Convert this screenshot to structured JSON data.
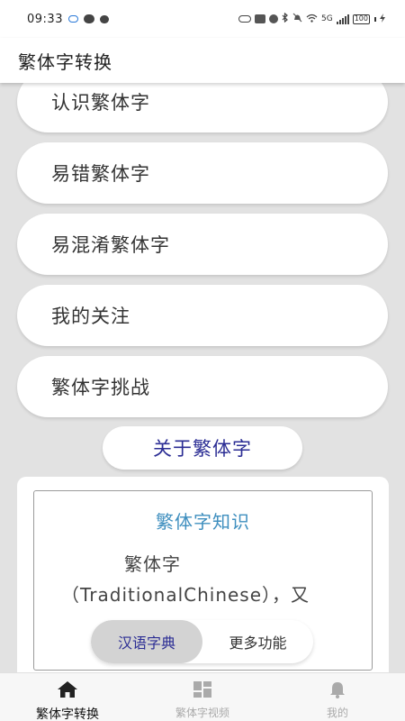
{
  "status_bar": {
    "time": "09:33",
    "signal_label": "5G",
    "battery": "100"
  },
  "header": {
    "title": "繁体字转换"
  },
  "menu": {
    "items": [
      {
        "label": "认识繁体字"
      },
      {
        "label": "易错繁体字"
      },
      {
        "label": "易混淆繁体字"
      },
      {
        "label": "我的关注"
      },
      {
        "label": "繁体字挑战"
      }
    ],
    "about_label": "关于繁体字"
  },
  "info_card": {
    "title": "繁体字知识",
    "text_line1": "繁体字",
    "text_line2": "（TraditionalChinese），又"
  },
  "segment": {
    "active_label": "汉语字典",
    "inactive_label": "更多功能"
  },
  "bottom_nav": {
    "items": [
      {
        "label": "繁体字转换",
        "icon": "home-icon"
      },
      {
        "label": "繁体字视频",
        "icon": "grid-icon"
      },
      {
        "label": "我的",
        "icon": "bell-icon"
      }
    ]
  },
  "colors": {
    "accent_text": "#2b2d94",
    "info_title": "#3f8fbf",
    "content_bg": "#e2e2e2"
  }
}
